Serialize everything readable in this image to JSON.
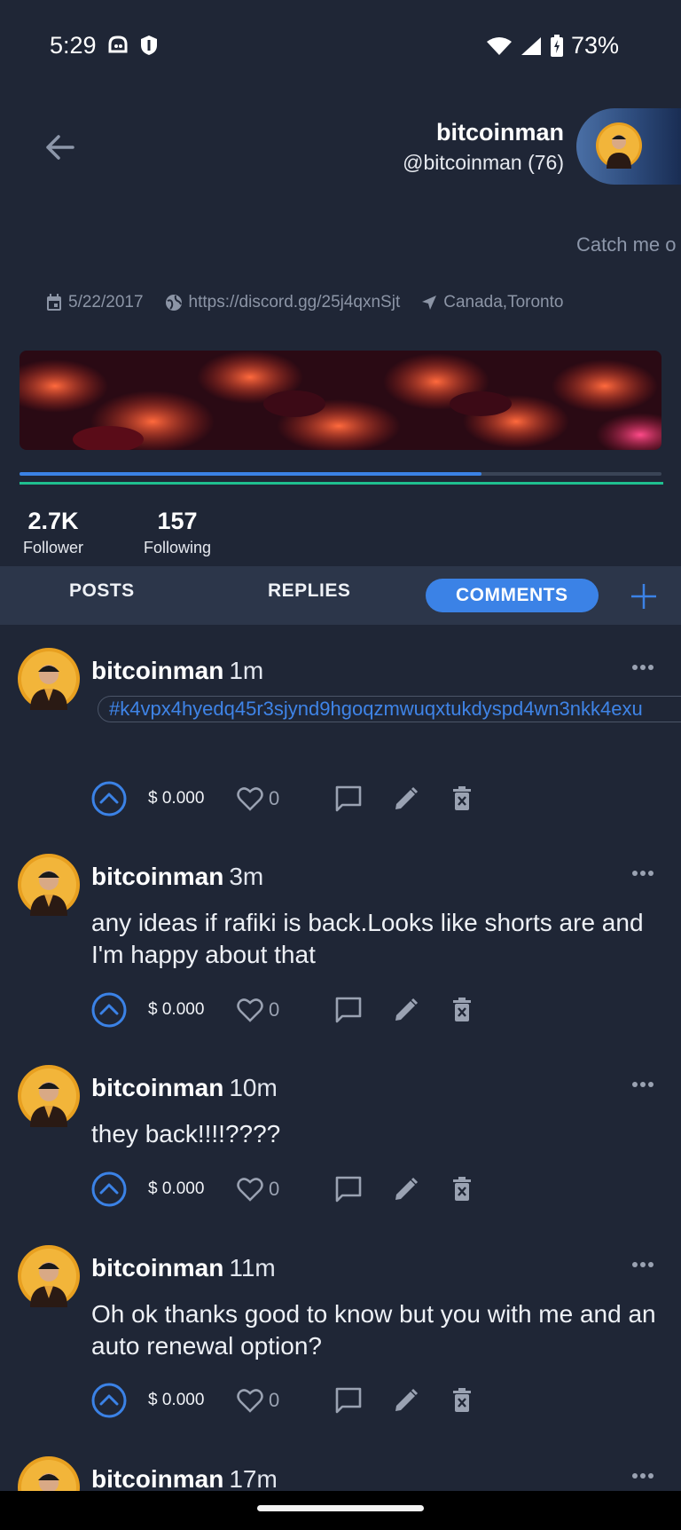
{
  "status_bar": {
    "time": "5:29",
    "battery": "73%"
  },
  "profile": {
    "name": "bitcoinman",
    "handle": "@bitcoinman (76)",
    "bio": "Catch me o",
    "joined": "5/22/2017",
    "website": "https://discord.gg/25j4qxnSjt",
    "location": "Canada,Toronto",
    "voting_power_pct": 72,
    "followers": "2.7K",
    "followers_label": "Follower",
    "following": "157",
    "following_label": "Following"
  },
  "tabs": [
    {
      "label": "POSTS",
      "active": false
    },
    {
      "label": "REPLIES",
      "active": false
    },
    {
      "label": "COMMENTS",
      "active": true
    }
  ],
  "posts": [
    {
      "author": "bitcoinman",
      "time": "1m",
      "tag": "#k4vpx4hyedq45r3sjynd9hgoqzmwuqxtukdyspd4wn3nkk4exu",
      "text": "",
      "payout": "$ 0.000",
      "likes": "0"
    },
    {
      "author": "bitcoinman",
      "time": "3m",
      "tag": "",
      "text": "any ideas if rafiki is back.Looks like shorts are and I'm happy about that",
      "payout": "$ 0.000",
      "likes": "0"
    },
    {
      "author": "bitcoinman",
      "time": "10m",
      "tag": "",
      "text": "they back!!!!????",
      "payout": "$ 0.000",
      "likes": "0"
    },
    {
      "author": "bitcoinman",
      "time": "11m",
      "tag": "",
      "text": "Oh ok thanks good to know but you with me and an auto renewal option?",
      "payout": "$ 0.000",
      "likes": "0"
    },
    {
      "author": "bitcoinman",
      "time": "17m",
      "tag": "",
      "text": "",
      "payout": "",
      "likes": ""
    }
  ],
  "colors": {
    "accent": "#3b82e6",
    "background": "#1f2636",
    "tab_bar": "#2c364a",
    "rc_bar": "#1fbf8f"
  }
}
